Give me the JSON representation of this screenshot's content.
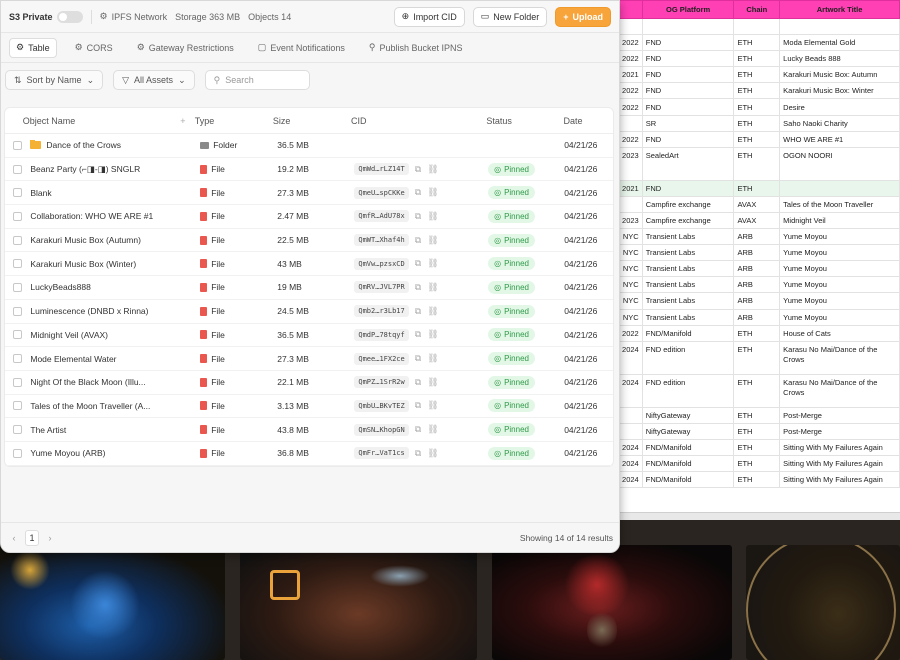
{
  "topbar": {
    "bucket_name": "S3 Private",
    "network_label": "IPFS Network",
    "storage_label": "Storage 363 MB",
    "objects_label": "Objects 14",
    "import_label": "Import CID",
    "new_folder_label": "New Folder",
    "upload_label": "Upload",
    "accent_color": "#f7a43a"
  },
  "tabs": [
    {
      "label": "Table",
      "icon": "table-icon"
    },
    {
      "label": "CORS",
      "icon": "globe-icon"
    },
    {
      "label": "Gateway Restrictions",
      "icon": "gateway-icon"
    },
    {
      "label": "Event Notifications",
      "icon": "notification-icon"
    },
    {
      "label": "Publish Bucket IPNS",
      "icon": "publish-icon"
    }
  ],
  "filters": {
    "sort_label": "Sort by Name",
    "assets_label": "All Assets",
    "search_placeholder": "Search"
  },
  "table": {
    "headers": {
      "name": "Object Name",
      "add": "+",
      "type": "Type",
      "size": "Size",
      "cid": "CID",
      "status": "Status",
      "date": "Date"
    },
    "rows": [
      {
        "name": "Dance of the Crows",
        "type": "Folder",
        "size": "36.5 MB",
        "cid": "",
        "status": "",
        "date": "04/21/26"
      },
      {
        "name": "Beanz Party (⌐◨-◨) SNGLR",
        "type": "File",
        "size": "19.2 MB",
        "cid": "QmWd…rLZ14T",
        "status": "Pinned",
        "date": "04/21/26"
      },
      {
        "name": "Blank",
        "type": "File",
        "size": "27.3 MB",
        "cid": "QmeU…spCKKe",
        "status": "Pinned",
        "date": "04/21/26"
      },
      {
        "name": "Collaboration: WHO WE ARE #1",
        "type": "File",
        "size": "2.47 MB",
        "cid": "QmfR…AdU78x",
        "status": "Pinned",
        "date": "04/21/26"
      },
      {
        "name": "Karakuri Music Box (Autumn)",
        "type": "File",
        "size": "22.5 MB",
        "cid": "QmWT…Xhaf4h",
        "status": "Pinned",
        "date": "04/21/26"
      },
      {
        "name": "Karakuri Music Box (Winter)",
        "type": "File",
        "size": "43 MB",
        "cid": "QmVw…pzsxCD",
        "status": "Pinned",
        "date": "04/21/26"
      },
      {
        "name": "LuckyBeads888",
        "type": "File",
        "size": "19 MB",
        "cid": "QmRV…JVL7PR",
        "status": "Pinned",
        "date": "04/21/26"
      },
      {
        "name": "Luminescence (DNBD x Rinna)",
        "type": "File",
        "size": "24.5 MB",
        "cid": "Qmb2…r3Lb17",
        "status": "Pinned",
        "date": "04/21/26"
      },
      {
        "name": "Midnight Veil (AVAX)",
        "type": "File",
        "size": "36.5 MB",
        "cid": "QmdP…78tqyf",
        "status": "Pinned",
        "date": "04/21/26"
      },
      {
        "name": "Mode Elemental Water",
        "type": "File",
        "size": "27.3 MB",
        "cid": "Qmee…1FX2ce",
        "status": "Pinned",
        "date": "04/21/26"
      },
      {
        "name": "Night Of the Black Moon (Illu...",
        "type": "File",
        "size": "22.1 MB",
        "cid": "QmPZ…1SrR2w",
        "status": "Pinned",
        "date": "04/21/26"
      },
      {
        "name": "Tales of the Moon Traveller (A...",
        "type": "File",
        "size": "3.13 MB",
        "cid": "QmbU…BKvTEZ",
        "status": "Pinned",
        "date": "04/21/26"
      },
      {
        "name": "The Artist",
        "type": "File",
        "size": "43.8 MB",
        "cid": "QmSN…KhopGN",
        "status": "Pinned",
        "date": "04/21/26"
      },
      {
        "name": "Yume Moyou (ARB)",
        "type": "File",
        "size": "36.8 MB",
        "cid": "QmFr…VaT1cs",
        "status": "Pinned",
        "date": "04/21/26"
      }
    ]
  },
  "footer": {
    "page": "1",
    "results_label": "Showing 14 of 14 results"
  },
  "sheet": {
    "headers": [
      "",
      "OG Platform",
      "Chain",
      "Artwork Title"
    ],
    "header_color": "#ff3fb4",
    "rows": [
      [
        "",
        "",
        "",
        ""
      ],
      [
        "2022",
        "FND",
        "ETH",
        "Moda Elemental Gold"
      ],
      [
        "2022",
        "FND",
        "ETH",
        "Lucky Beads 888"
      ],
      [
        "2021",
        "FND",
        "ETH",
        "Karakuri Music Box: Autumn"
      ],
      [
        "2022",
        "FND",
        "ETH",
        "Karakuri Music Box: Winter"
      ],
      [
        "2022",
        "FND",
        "ETH",
        "Desire"
      ],
      [
        "",
        "SR",
        "ETH",
        "Saho Naoki Charity"
      ],
      [
        "2022",
        "FND",
        "ETH",
        "WHO WE ARE #1"
      ],
      [
        "2023",
        "SealedArt",
        "ETH",
        "OGON NOORI"
      ],
      [
        "2021",
        "FND",
        "ETH",
        ""
      ],
      [
        "",
        "Campfire exchange",
        "AVAX",
        "Tales of the Moon Traveller"
      ],
      [
        "2023",
        "Campfire exchange",
        "AVAX",
        "Midnight Veil"
      ],
      [
        "NYC",
        "Transient Labs",
        "ARB",
        "Yume Moyou"
      ],
      [
        "NYC",
        "Transient Labs",
        "ARB",
        "Yume Moyou"
      ],
      [
        "NYC",
        "Transient Labs",
        "ARB",
        "Yume Moyou"
      ],
      [
        "NYC",
        "Transient Labs",
        "ARB",
        "Yume Moyou"
      ],
      [
        "NYC",
        "Transient Labs",
        "ARB",
        "Yume Moyou"
      ],
      [
        "NYC",
        "Transient Labs",
        "ARB",
        "Yume Moyou"
      ],
      [
        "2022",
        "FND/Manifold",
        "ETH",
        "House of Cats"
      ],
      [
        "2024",
        "FND edition",
        "ETH",
        "Karasu No Mai/Dance of the Crows"
      ],
      [
        "2024",
        "FND edition",
        "ETH",
        "Karasu No Mai/Dance of the Crows"
      ],
      [
        "",
        "NiftyGateway",
        "ETH",
        "Post-Merge"
      ],
      [
        "",
        "NiftyGateway",
        "ETH",
        "Post-Merge"
      ],
      [
        "2024",
        "FND/Manifold",
        "ETH",
        "Sitting With My Failures Again"
      ],
      [
        "2024",
        "FND/Manifold",
        "ETH",
        "Sitting With My Failures Again"
      ],
      [
        "2024",
        "FND/Manifold",
        "ETH",
        "Sitting With My Failures Again"
      ]
    ]
  }
}
